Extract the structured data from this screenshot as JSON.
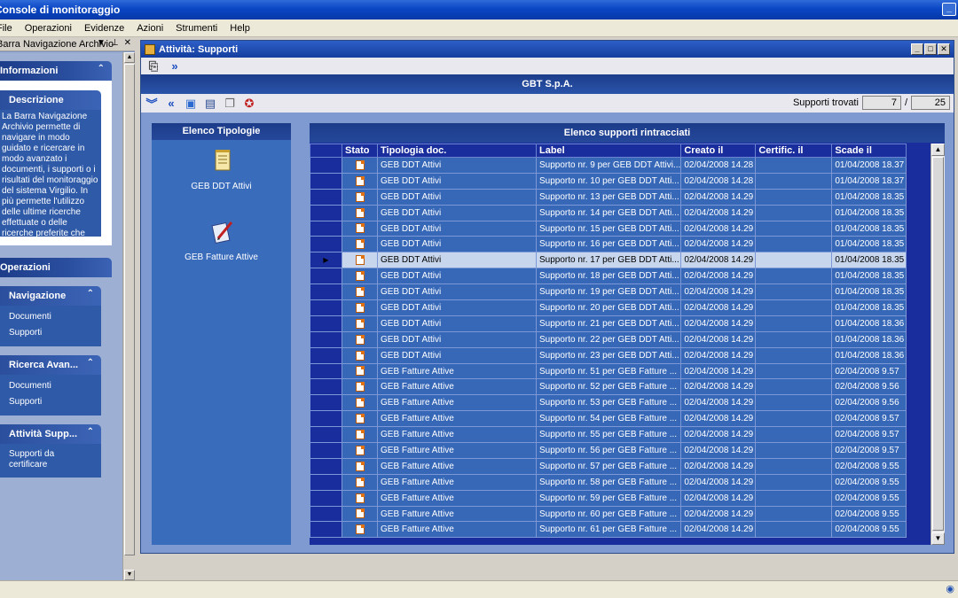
{
  "app": {
    "title": "Console di monitoraggio"
  },
  "menu": [
    "File",
    "Operazioni",
    "Evidenze",
    "Azioni",
    "Strumenti",
    "Help"
  ],
  "left_panel": {
    "title": "Barra Navigazione Archivio",
    "informazioni": {
      "title": "Informazioni",
      "descrizione_title": "Descrizione",
      "descrizione_text": "La Barra Navigazione Archivio permette di navigare in modo guidato e ricercare in modo avanzato i documenti, i supporti o i risultati del monitoraggio del sistema Virgilio. In più permette l'utilizzo delle ultime ricerche effettuate o delle ricerche preferite che sono state eseguite a"
    },
    "operazioni": {
      "title": "Operazioni",
      "navigazione": {
        "title": "Navigazione",
        "items": [
          "Documenti",
          "Supporti"
        ]
      },
      "ricerca": {
        "title": "Ricerca Avan...",
        "items": [
          "Documenti",
          "Supporti"
        ]
      },
      "attivita": {
        "title": "Attività Supp...",
        "items": [
          "Supporti da certificare"
        ]
      }
    }
  },
  "child": {
    "title": "Attività: Supporti",
    "company": "GBT S.p.A.",
    "counter_label": "Supporti trovati",
    "counter_current": "7",
    "counter_sep": "/",
    "counter_total": "25",
    "tipologie": {
      "title": "Elenco Tipologie",
      "items": [
        {
          "label": "GEB DDT Attivi",
          "icon": "notepad-icon"
        },
        {
          "label": "GEB Fatture Attive",
          "icon": "pen-document-icon"
        }
      ]
    },
    "grid": {
      "title": "Elenco supporti rintracciati",
      "columns": [
        "Stato",
        "Tipologia doc.",
        "Label",
        "Creato il",
        "Certific. il",
        "Scade il"
      ],
      "selected_index": 6,
      "rows": [
        [
          "GEB DDT Attivi",
          "Supporto nr. 9 per GEB DDT Attivi...",
          "02/04/2008 14.28",
          "",
          "01/04/2008 18.37"
        ],
        [
          "GEB DDT Attivi",
          "Supporto nr. 10 per GEB DDT Atti...",
          "02/04/2008 14.28",
          "",
          "01/04/2008 18.37"
        ],
        [
          "GEB DDT Attivi",
          "Supporto nr. 13 per GEB DDT Atti...",
          "02/04/2008 14.29",
          "",
          "01/04/2008 18.35"
        ],
        [
          "GEB DDT Attivi",
          "Supporto nr. 14 per GEB DDT Atti...",
          "02/04/2008 14.29",
          "",
          "01/04/2008 18.35"
        ],
        [
          "GEB DDT Attivi",
          "Supporto nr. 15 per GEB DDT Atti...",
          "02/04/2008 14.29",
          "",
          "01/04/2008 18.35"
        ],
        [
          "GEB DDT Attivi",
          "Supporto nr. 16 per GEB DDT Atti...",
          "02/04/2008 14.29",
          "",
          "01/04/2008 18.35"
        ],
        [
          "GEB DDT Attivi",
          "Supporto nr. 17 per GEB DDT Atti...",
          "02/04/2008 14.29",
          "",
          "01/04/2008 18.35"
        ],
        [
          "GEB DDT Attivi",
          "Supporto nr. 18 per GEB DDT Atti...",
          "02/04/2008 14.29",
          "",
          "01/04/2008 18.35"
        ],
        [
          "GEB DDT Attivi",
          "Supporto nr. 19 per GEB DDT Atti...",
          "02/04/2008 14.29",
          "",
          "01/04/2008 18.35"
        ],
        [
          "GEB DDT Attivi",
          "Supporto nr. 20 per GEB DDT Atti...",
          "02/04/2008 14.29",
          "",
          "01/04/2008 18.35"
        ],
        [
          "GEB DDT Attivi",
          "Supporto nr. 21 per GEB DDT Atti...",
          "02/04/2008 14.29",
          "",
          "01/04/2008 18.36"
        ],
        [
          "GEB DDT Attivi",
          "Supporto nr. 22 per GEB DDT Atti...",
          "02/04/2008 14.29",
          "",
          "01/04/2008 18.36"
        ],
        [
          "GEB DDT Attivi",
          "Supporto nr. 23 per GEB DDT Atti...",
          "02/04/2008 14.29",
          "",
          "01/04/2008 18.36"
        ],
        [
          "GEB Fatture Attive",
          "Supporto nr. 51 per GEB Fatture ...",
          "02/04/2008 14.29",
          "",
          "02/04/2008 9.57"
        ],
        [
          "GEB Fatture Attive",
          "Supporto nr. 52 per GEB Fatture ...",
          "02/04/2008 14.29",
          "",
          "02/04/2008 9.56"
        ],
        [
          "GEB Fatture Attive",
          "Supporto nr. 53 per GEB Fatture ...",
          "02/04/2008 14.29",
          "",
          "02/04/2008 9.56"
        ],
        [
          "GEB Fatture Attive",
          "Supporto nr. 54 per GEB Fatture ...",
          "02/04/2008 14.29",
          "",
          "02/04/2008 9.57"
        ],
        [
          "GEB Fatture Attive",
          "Supporto nr. 55 per GEB Fatture ...",
          "02/04/2008 14.29",
          "",
          "02/04/2008 9.57"
        ],
        [
          "GEB Fatture Attive",
          "Supporto nr. 56 per GEB Fatture ...",
          "02/04/2008 14.29",
          "",
          "02/04/2008 9.57"
        ],
        [
          "GEB Fatture Attive",
          "Supporto nr. 57 per GEB Fatture ...",
          "02/04/2008 14.29",
          "",
          "02/04/2008 9.55"
        ],
        [
          "GEB Fatture Attive",
          "Supporto nr. 58 per GEB Fatture ...",
          "02/04/2008 14.29",
          "",
          "02/04/2008 9.55"
        ],
        [
          "GEB Fatture Attive",
          "Supporto nr. 59 per GEB Fatture ...",
          "02/04/2008 14.29",
          "",
          "02/04/2008 9.55"
        ],
        [
          "GEB Fatture Attive",
          "Supporto nr. 60 per GEB Fatture ...",
          "02/04/2008 14.29",
          "",
          "02/04/2008 9.55"
        ],
        [
          "GEB Fatture Attive",
          "Supporto nr. 61 per GEB Fatture ...",
          "02/04/2008 14.29",
          "",
          "02/04/2008 9.55"
        ]
      ]
    }
  },
  "icons": {
    "toolbar1": [
      "exit-icon",
      "forward-double-icon"
    ],
    "toolbar2": [
      "expand-down-icon",
      "back-double-icon",
      "refresh-icon",
      "save-icon",
      "copy-icon",
      "certificate-icon"
    ]
  },
  "colors": {
    "titlebar": "#0a46c4",
    "panel_blue": "#3768b8",
    "grid_dark": "#1a2d9c",
    "selected_row": "#c7d6ec"
  }
}
